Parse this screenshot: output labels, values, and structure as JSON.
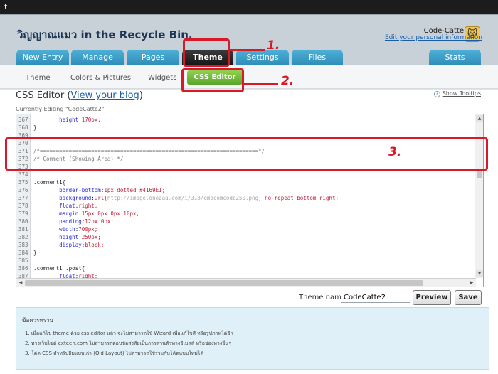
{
  "window": {
    "title": "t"
  },
  "header": {
    "blog_title": "วิญญาณแมว in the Recycle Bin.",
    "user_name": "Code-Catte",
    "user_edit_link": "Edit your personal information",
    "avatar_glyph": "🐱"
  },
  "main_tabs": [
    {
      "label": "New Entry",
      "active": false
    },
    {
      "label": "Manage",
      "active": false
    },
    {
      "label": "Pages",
      "active": false
    },
    {
      "label": "Theme",
      "active": true
    },
    {
      "label": "Settings",
      "active": false
    },
    {
      "label": "Files",
      "active": false
    },
    {
      "label": "Stats",
      "active": false
    }
  ],
  "sub_tabs": [
    {
      "label": "Theme",
      "active": false
    },
    {
      "label": "Colors & Pictures",
      "active": false
    },
    {
      "label": "Widgets",
      "active": false
    },
    {
      "label": "CSS Editor",
      "active": true
    }
  ],
  "page": {
    "heading": "CSS Editor (",
    "heading_link": "View your blog",
    "heading_close": ")",
    "tooltips_link": "Show Tooltips",
    "currently_editing": "Currently Editing \"CodeCatte2\""
  },
  "code_lines": [
    {
      "num": "367",
      "text": "        height:170px;"
    },
    {
      "num": "368",
      "text": "}"
    },
    {
      "num": "369",
      "text": ""
    },
    {
      "num": "370",
      "text": ""
    },
    {
      "num": "371",
      "text": "/*====================================================================*/"
    },
    {
      "num": "372",
      "text": "/* Comment (Showing Area) */"
    },
    {
      "num": "373",
      "text": ""
    },
    {
      "num": "374",
      "text": ""
    },
    {
      "num": "375",
      "text": ".comment1{"
    },
    {
      "num": "376",
      "text": "        border-bottom:1px dotted #4169E1;"
    },
    {
      "num": "377",
      "text": "        background:url(http://image.ohozaa.com/i/318/emocomcode250.png) no-repeat bottom right;"
    },
    {
      "num": "378",
      "text": "        float:right;"
    },
    {
      "num": "379",
      "text": "        margin:15px 0px 0px 10px;"
    },
    {
      "num": "380",
      "text": "        padding:12px 0px;"
    },
    {
      "num": "381",
      "text": "        width:700px;"
    },
    {
      "num": "382",
      "text": "        height:250px;"
    },
    {
      "num": "383",
      "text": "        display:block;"
    },
    {
      "num": "384",
      "text": "}"
    },
    {
      "num": "385",
      "text": ""
    },
    {
      "num": "386",
      "text": ".comment1 .post{"
    },
    {
      "num": "387",
      "text": "        float:right;"
    }
  ],
  "theme_form": {
    "label": "Theme name:",
    "value": "CodeCatte2",
    "preview_label": "Preview",
    "save_label": "Save"
  },
  "notes": {
    "title": "ข้อควรทราบ",
    "items": [
      "1.  เมื่อแก้ไข theme ด้วย css editor แล้ว จะไม่สามารถใช้ Wizard เพื่อแก้ไขสี หรือรูปภาพได้อีก",
      "2.  ทางเว็บไซต์ exteen.com ไม่สามารถตอบข้อสงสัยเป็นการส่วนตัวทางอีเมลล์ หรือช่องทางอื่นๆ",
      "3.  โค้ด CSS สำหรับธีมแบบเก่า (Old Layout) ไม่สามารถใช้ร่วมกับโค้ดแบบใหม่ได้"
    ]
  },
  "annotations": {
    "m1": "1.",
    "m2": "2.",
    "m3": "3."
  },
  "colors": {
    "accent_red": "#d8192a",
    "tab_blue": "#2d8db8",
    "active_green": "#5aa62a"
  }
}
